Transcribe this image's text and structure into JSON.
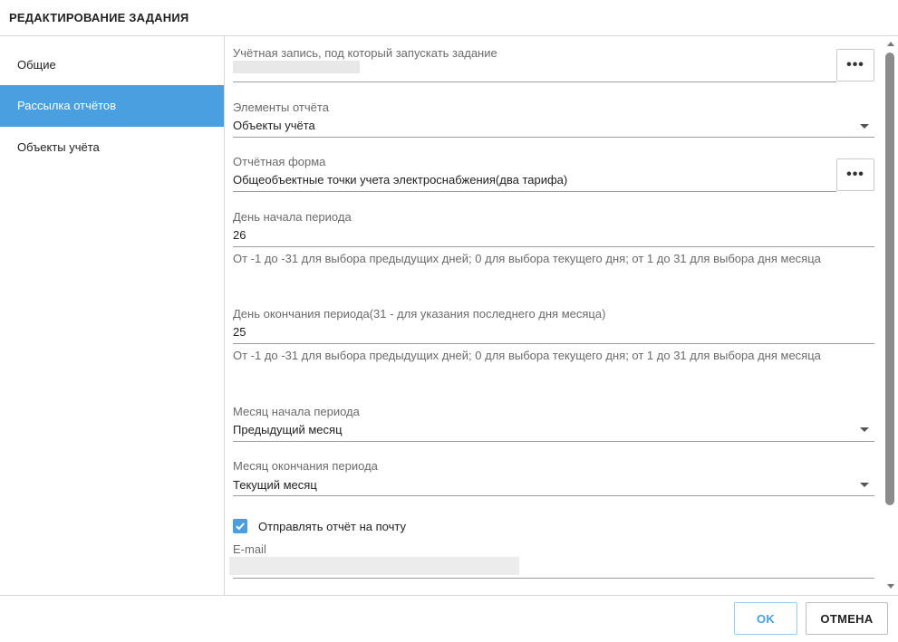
{
  "dialog": {
    "title": "РЕДАКТИРОВАНИЕ ЗАДАНИЯ"
  },
  "sidebar": {
    "items": [
      {
        "label": "Общие"
      },
      {
        "label": "Рассылка отчётов",
        "active": true
      },
      {
        "label": "Объекты учёта"
      }
    ]
  },
  "form": {
    "account": {
      "label": "Учётная запись, под который запускать задание",
      "value": ""
    },
    "report_elements": {
      "label": "Элементы отчёта",
      "value": "Объекты учёта"
    },
    "report_form": {
      "label": "Отчётная форма",
      "value": "Общеобъектные точки учета электроснабжения(два тарифа)"
    },
    "period_start_day": {
      "label": "День начала периода",
      "value": "26",
      "hint": "От -1 до -31 для выбора предыдущих дней; 0 для выбора текущего дня; от 1 до 31 для выбора дня месяца"
    },
    "period_end_day": {
      "label": "День окончания периода(31 - для указания последнего дня месяца)",
      "value": "25",
      "hint": "От -1 до -31 для выбора предыдущих дней; 0 для выбора текущего дня; от 1 до 31 для выбора дня месяца"
    },
    "period_start_month": {
      "label": "Месяц начала периода",
      "value": "Предыдущий месяц"
    },
    "period_end_month": {
      "label": "Месяц окончания периода",
      "value": "Текущий месяц"
    },
    "send_email": {
      "label": "Отправлять отчёт на почту",
      "checked": true
    },
    "email": {
      "label": "E-mail",
      "value": ""
    },
    "ellipsis_label": "•••"
  },
  "footer": {
    "ok_label": "OK",
    "cancel_label": "ОТМЕНА"
  },
  "colors": {
    "accent": "#4a9fe0",
    "text": "#212121",
    "muted": "#6b6b6b"
  },
  "icons": {
    "checkbox": "check-icon",
    "dropdown": "chevron-down-icon",
    "more": "ellipsis-icon"
  }
}
